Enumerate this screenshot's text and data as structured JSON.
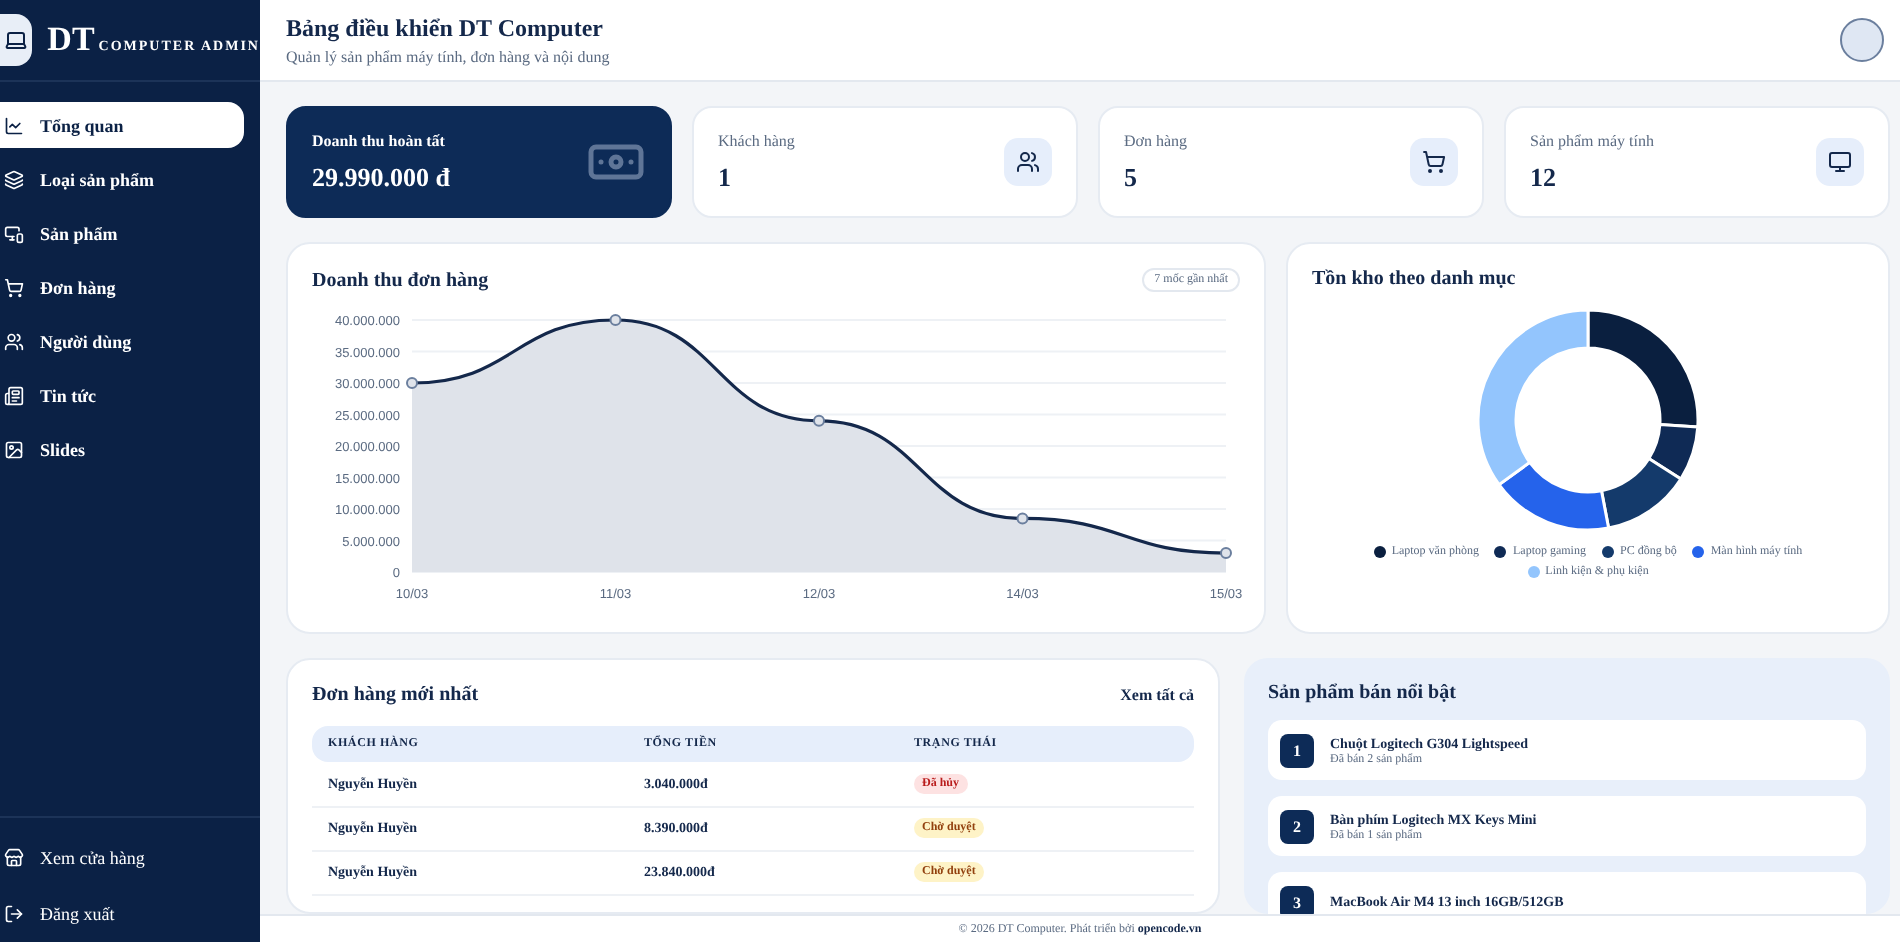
{
  "brand": {
    "title": "DT",
    "subtitle": "COMPUTER ADMIN"
  },
  "sidebar": {
    "items": [
      {
        "label": "Tổng quan",
        "selected": true
      },
      {
        "label": "Loại sản phẩm",
        "selected": false
      },
      {
        "label": "Sản phẩm",
        "selected": false
      },
      {
        "label": "Đơn hàng",
        "selected": false
      },
      {
        "label": "Người dùng",
        "selected": false
      },
      {
        "label": "Tin tức",
        "selected": false
      },
      {
        "label": "Slides",
        "selected": false
      }
    ],
    "bottom_items": [
      {
        "label": "Xem cửa hàng"
      },
      {
        "label": "Đăng xuất"
      }
    ]
  },
  "header": {
    "title": "Bảng điều khiển DT Computer",
    "subtitle": "Quản lý sản phẩm máy tính, đơn hàng và nội dung"
  },
  "stats": [
    {
      "label": "Doanh thu hoàn tất",
      "value": "29.990.000 đ",
      "kind": "highlight"
    },
    {
      "label": "Khách hàng",
      "value": "1",
      "kind": "plain"
    },
    {
      "label": "Đơn hàng",
      "value": "5",
      "kind": "plain"
    },
    {
      "label": "Sản phẩm máy tính",
      "value": "12",
      "kind": "plain"
    }
  ],
  "revenue": {
    "title": "Doanh thu đơn hàng",
    "badge": "7 mốc gần nhất",
    "chart_data": {
      "type": "area",
      "categories": [
        "10/03",
        "11/03",
        "12/03",
        "14/03",
        "15/03"
      ],
      "series": [
        {
          "color": "#14284b",
          "values": [
            30000000,
            40000000,
            24000000,
            8500000,
            3000000
          ]
        }
      ],
      "grid": true,
      "ylim": [
        0,
        40000000
      ],
      "yticks": [
        {
          "value": 0,
          "label": "0"
        },
        {
          "value": 5000000,
          "label": "5.000.000"
        },
        {
          "value": 10000000,
          "label": "10.000.000"
        },
        {
          "value": 15000000,
          "label": "15.000.000"
        },
        {
          "value": 20000000,
          "label": "20.000.000"
        },
        {
          "value": 25000000,
          "label": "25.000.000"
        },
        {
          "value": 30000000,
          "label": "30.000.000"
        },
        {
          "value": 35000000,
          "label": "35.000.000"
        },
        {
          "value": 40000000,
          "label": "40.000.000"
        }
      ]
    }
  },
  "stock": {
    "title": "Tồn kho theo danh mục",
    "legend": [
      {
        "label": "Laptop văn phòng",
        "color": "#0a1f3f"
      },
      {
        "label": "Laptop gaming",
        "color": "#0f2a55"
      },
      {
        "label": "PC đồng bộ",
        "color": "#143a6b"
      },
      {
        "label": "Màn hình máy tính",
        "color": "#2563eb"
      },
      {
        "label": "Linh kiện & phụ kiện",
        "color": "#93c5fd"
      }
    ]
  },
  "orders": {
    "title": "Đơn hàng mới nhất",
    "link": "Xem tất cả",
    "columns": [
      "KHÁCH HÀNG",
      "TỔNG TIỀN",
      "TRẠNG THÁI"
    ],
    "rows": [
      {
        "customer": "Nguyễn Huyền",
        "total": "3.040.000đ",
        "status": "Đã hủy",
        "kind": "cancelled"
      },
      {
        "customer": "Nguyễn Huyền",
        "total": "8.390.000đ",
        "status": "Chờ duyệt",
        "kind": "pending"
      },
      {
        "customer": "Nguyễn Huyền",
        "total": "23.840.000đ",
        "status": "Chờ duyệt",
        "kind": "pending"
      }
    ]
  },
  "top_products": {
    "title": "Sản phẩm bán nổi bật",
    "items": [
      {
        "rank": "1",
        "name": "Chuột Logitech G304 Lightspeed",
        "sold": "Đã bán 2 sản phẩm"
      },
      {
        "rank": "2",
        "name": "Bàn phím Logitech MX Keys Mini",
        "sold": "Đã bán 1 sản phẩm"
      },
      {
        "rank": "3",
        "name": "MacBook Air M4 13 inch 16GB/512GB"
      }
    ]
  },
  "footer": {
    "text": "© 2026 DT Computer. Phát triển bởi ",
    "link": "opencode.vn"
  }
}
